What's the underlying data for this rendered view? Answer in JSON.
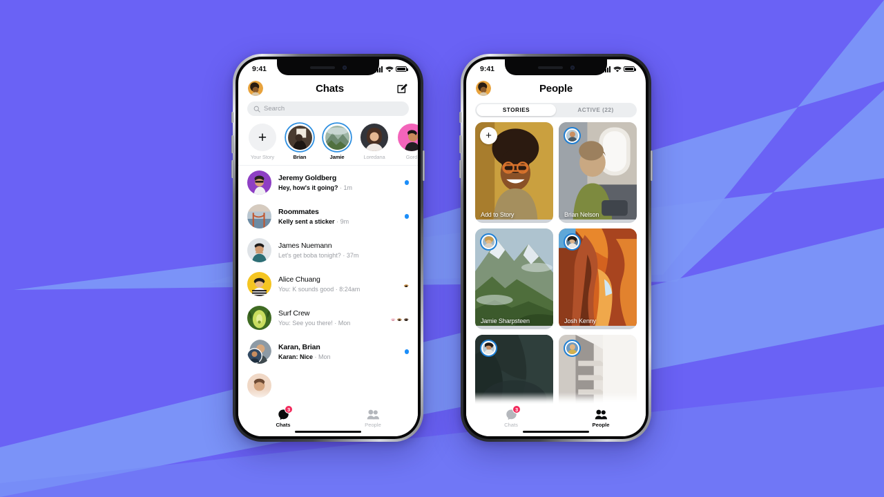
{
  "background": {
    "base_color": "#6a62f5",
    "wedge_color": "#7d97f7"
  },
  "phones": {
    "left": {
      "status_bar": {
        "time": "9:41",
        "signal": "cellular-bars-icon",
        "wifi": "wifi-icon",
        "battery": "battery-full-icon"
      },
      "header": {
        "title": "Chats",
        "avatar": "profile-avatar",
        "compose": "compose-icon"
      },
      "search": {
        "placeholder": "Search",
        "icon": "search-icon"
      },
      "stories": [
        {
          "name": "Your Story",
          "type": "add",
          "ring": false,
          "online": false
        },
        {
          "name": "Brian",
          "type": "photo",
          "ring": true,
          "online": false
        },
        {
          "name": "Jamie",
          "type": "photo",
          "ring": true,
          "online": false
        },
        {
          "name": "Loredana",
          "type": "photo",
          "ring": false,
          "online": true
        },
        {
          "name": "Gord",
          "type": "photo",
          "ring": false,
          "online": false
        }
      ],
      "chats": [
        {
          "name": "Jeremy Goldberg",
          "snippet": "Hey, how's it going?",
          "time": "1m",
          "unread": true,
          "status": "dot"
        },
        {
          "name": "Roommates",
          "snippet": "Kelly sent a sticker",
          "time": "9m",
          "unread": true,
          "status": "dot"
        },
        {
          "name": "James Nuemann",
          "snippet": "Let's get boba tonight?",
          "time": "37m",
          "unread": false,
          "status": "none"
        },
        {
          "name": "Alice Chuang",
          "snippet": "You: K sounds good",
          "time": "8:24am",
          "unread": false,
          "status": "seen-one"
        },
        {
          "name": "Surf Crew",
          "snippet": "You: See you there!",
          "time": "Mon",
          "unread": false,
          "status": "seen-many"
        },
        {
          "name": "Karan, Brian",
          "snippet": "Karan: Nice",
          "time": "Mon",
          "unread": true,
          "status": "dot"
        }
      ],
      "tabs": [
        {
          "label": "Chats",
          "icon": "chat-bubble-icon",
          "active": true,
          "badge": "3"
        },
        {
          "label": "People",
          "icon": "people-icon",
          "active": false,
          "badge": ""
        }
      ]
    },
    "right": {
      "status_bar": {
        "time": "9:41",
        "signal": "cellular-bars-icon",
        "wifi": "wifi-icon",
        "battery": "battery-full-icon"
      },
      "header": {
        "title": "People",
        "avatar": "profile-avatar"
      },
      "segments": [
        {
          "label": "STORIES",
          "active": true
        },
        {
          "label": "ACTIVE (22)",
          "active": false
        }
      ],
      "story_cards": [
        {
          "name": "Add to Story",
          "kind": "add",
          "art": "portrait-woman-yellow"
        },
        {
          "name": "Brian Nelson",
          "kind": "story",
          "art": "child-airplane-window"
        },
        {
          "name": "Jamie Sharpsteen",
          "kind": "story",
          "art": "green-mountain"
        },
        {
          "name": "Josh Kenny",
          "kind": "story",
          "art": "orange-slot-canyon"
        },
        {
          "name": "",
          "kind": "story",
          "art": "dark-rock-wall"
        },
        {
          "name": "",
          "kind": "story",
          "art": "white-staircase"
        }
      ],
      "tabs": [
        {
          "label": "Chats",
          "icon": "chat-bubble-icon",
          "active": false,
          "badge": "3"
        },
        {
          "label": "People",
          "icon": "people-icon",
          "active": true,
          "badge": ""
        }
      ]
    }
  }
}
